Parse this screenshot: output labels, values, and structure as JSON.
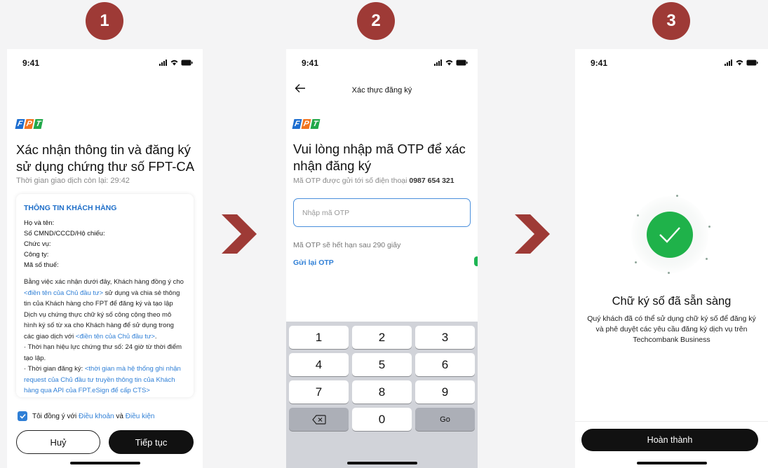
{
  "steps": [
    "1",
    "2",
    "3"
  ],
  "colors": {
    "badge": "#9e3a36",
    "fpt_blue": "#1d6ed0",
    "fpt_orange": "#f2741e",
    "fpt_green": "#22a84a",
    "link": "#2f7fd6",
    "success": "#1fb24a"
  },
  "status_time": "9:41",
  "logo_letters": [
    "F",
    "P",
    "T"
  ],
  "screen1": {
    "title": "Xác nhận thông tin và đăng ký sử dụng chứng thư số FPT-CA",
    "subtitle": "Thời gian giao dịch còn lại: 29:42",
    "card_heading": "THÔNG TIN KHÁCH HÀNG",
    "fields": [
      "Họ và tên:",
      "Số CMND/CCCD/Hộ chiếu:",
      "Chức vụ:",
      "Công ty:",
      "Mã số thuế:"
    ],
    "terms": {
      "p1_a": "Bằng việc xác nhận dưới đây, Khách hàng đồng ý cho ",
      "p1_link1": "<điền tên của Chủ đầu tư>",
      "p1_b": " sử dụng và chia sẻ thông tin của Khách hàng cho FPT để đăng ký và tạo lập Dịch vụ chứng thực chữ ký số công cộng theo mô hình ký số từ xa cho Khách hàng để sử dụng trong các giao dịch với ",
      "p1_link2": "<điền tên của Chủ đầu tư>",
      "p1_c": ".",
      "p2": "· Thời hạn hiệu lực chứng thư số: 24 giờ từ thời điểm tạo lập.",
      "p3_a": "· Thời gian đăng ký: ",
      "p3_link": "<thời gian mà hệ thống ghi nhận request của Chủ đầu tư truyền thông tin của Khách hàng qua API của FPT.eSign để cấp CTS>"
    },
    "agree_prefix": "Tôi đồng ý với ",
    "agree_link1": "Điều khoản",
    "agree_mid": " và ",
    "agree_link2": "Điều kiện",
    "cancel_label": "Huỷ",
    "next_label": "Tiếp tục"
  },
  "screen2": {
    "header_title": "Xác thực đăng ký",
    "title": "Vui lòng nhập mã OTP để xác nhận đăng ký",
    "subtitle_prefix": "Mã OTP được gửi tới số điện thoại ",
    "phone": "0987 654 321",
    "otp_placeholder": "Nhập mã OTP",
    "expiry": "Mã OTP sẽ hết hạn sau 290 giây",
    "resend": "Gửi lại OTP",
    "keys": [
      [
        "1",
        "2",
        "3"
      ],
      [
        "4",
        "5",
        "6"
      ],
      [
        "7",
        "8",
        "9"
      ]
    ],
    "zero": "0",
    "go": "Go"
  },
  "screen3": {
    "title": "Chữ ký số đã sẵn sàng",
    "description": "Quý khách đã có thể sử dụng chữ ký số để đăng ký và phê duyệt các yêu cầu đăng ký dịch vụ trên Techcombank Business",
    "done_label": "Hoàn thành"
  }
}
